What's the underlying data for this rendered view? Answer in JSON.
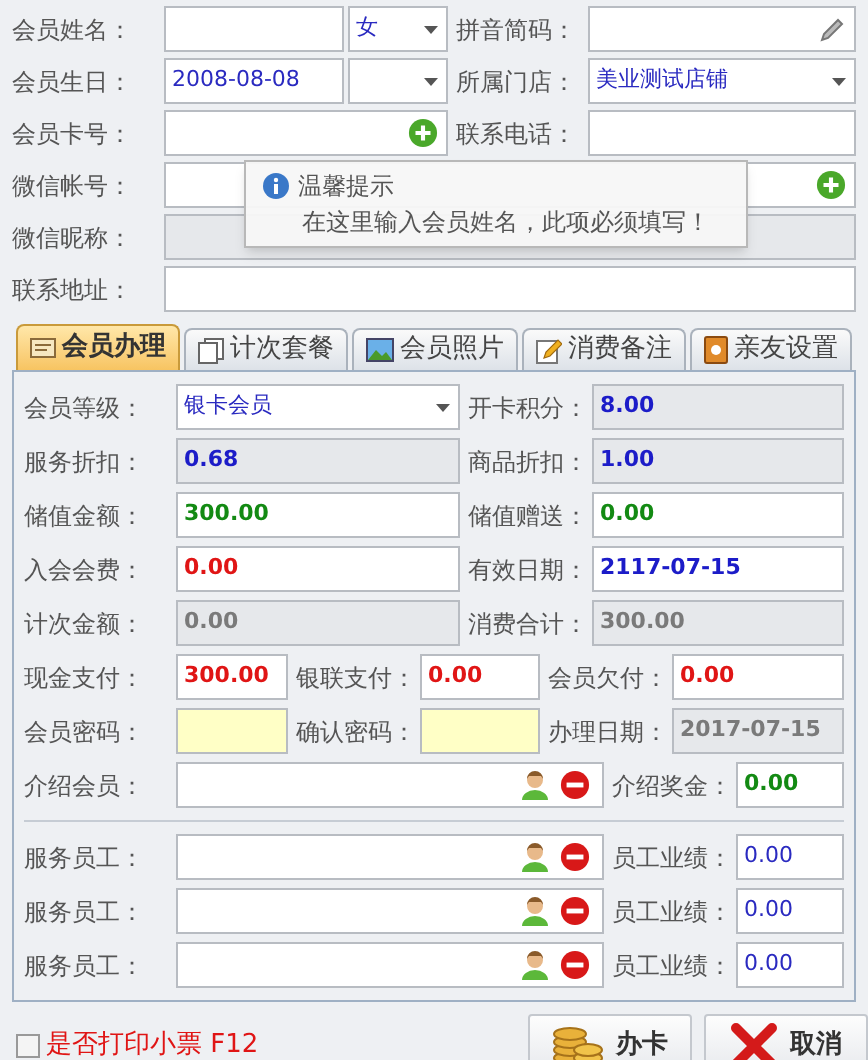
{
  "top_rows": [
    {
      "left": [
        {
          "label": "会员姓名：",
          "kind": "input"
        },
        {
          "kind": "select",
          "value": "女",
          "color": "#2a2ac0",
          "bold": false
        }
      ],
      "right": [
        {
          "label": "拼音简码：",
          "kind": "edit"
        }
      ]
    },
    {
      "left": [
        {
          "label": "会员生日：",
          "kind": "input",
          "value": "2008-08-08",
          "color": "#2a2ac0",
          "bold": false
        },
        {
          "kind": "select"
        }
      ],
      "right": [
        {
          "label": "所属门店：",
          "kind": "select",
          "value": "美业测试店铺",
          "color": "#2a2ac0",
          "bold": false
        }
      ]
    },
    {
      "left": [
        {
          "label": "会员卡号：",
          "kind": "add"
        }
      ],
      "right": [
        {
          "label": "联系电话：",
          "kind": "input"
        }
      ]
    },
    {
      "left": [
        {
          "label": "微信帐号：",
          "kind": "add"
        }
      ]
    },
    {
      "left": [
        {
          "label": "微信昵称：",
          "kind": "readonly"
        }
      ]
    },
    {
      "left": [
        {
          "label": "联系地址：",
          "kind": "input"
        }
      ]
    }
  ],
  "tooltip": {
    "title": "温馨提示",
    "message": "在这里输入会员姓名，此项必须填写！"
  },
  "tabs": [
    {
      "label": "会员办理",
      "selected": true,
      "kind": "card"
    },
    {
      "label": "计次套餐",
      "selected": false,
      "kind": "pages"
    },
    {
      "label": "会员照片",
      "selected": false,
      "kind": "photo"
    },
    {
      "label": "消费备注",
      "selected": false,
      "kind": "note"
    },
    {
      "label": "亲友设置",
      "selected": false,
      "kind": "contacts"
    }
  ],
  "panel_rows": [
    {
      "kind": "fields",
      "cells": [
        {
          "label": "会员等级：",
          "kind": "select",
          "value": "银卡会员",
          "color": "#2a2ac0",
          "bold": false
        },
        {
          "label": "开卡积分：",
          "kind": "readonly",
          "value": "8.00",
          "color": "#1c1cc8",
          "bold": true
        }
      ]
    },
    {
      "kind": "fields",
      "cells": [
        {
          "label": "服务折扣：",
          "kind": "readonly",
          "value": "0.68",
          "color": "#1c1cc8",
          "bold": true
        },
        {
          "label": "商品折扣：",
          "kind": "readonly",
          "value": "1.00",
          "color": "#1c1cc8",
          "bold": true
        }
      ]
    },
    {
      "kind": "fields",
      "cells": [
        {
          "label": "储值金额：",
          "kind": "input",
          "value": "300.00",
          "color": "#138a13",
          "bold": true
        },
        {
          "label": "储值赠送：",
          "kind": "input",
          "value": "0.00",
          "color": "#138a13",
          "bold": true
        }
      ]
    },
    {
      "kind": "fields",
      "cells": [
        {
          "label": "入会会费：",
          "kind": "input",
          "value": "0.00",
          "color": "#e01515",
          "bold": true
        },
        {
          "label": "有效日期：",
          "kind": "input",
          "value": "2117-07-15",
          "color": "#1c1cc8",
          "bold": true
        }
      ]
    },
    {
      "kind": "fields",
      "cells": [
        {
          "label": "计次金额：",
          "kind": "readonly",
          "value": "0.00",
          "color": "#7a7a7a",
          "bold": true
        },
        {
          "label": "消费合计：",
          "kind": "readonly",
          "value": "300.00",
          "color": "#7a7a7a",
          "bold": true
        }
      ]
    },
    {
      "kind": "fields",
      "cells": [
        {
          "label": "现金支付：",
          "kind": "input",
          "value": "300.00",
          "color": "#e01515",
          "bold": true
        },
        {
          "label": "银联支付：",
          "kind": "input",
          "value": "0.00",
          "color": "#e01515",
          "bold": true
        },
        {
          "label": "会员欠付：",
          "kind": "input",
          "value": "0.00",
          "color": "#e01515",
          "bold": true
        }
      ]
    },
    {
      "kind": "fields",
      "cells": [
        {
          "label": "会员密码：",
          "kind": "password"
        },
        {
          "label": "确认密码：",
          "kind": "password"
        },
        {
          "label": "办理日期：",
          "kind": "readonly",
          "value": "2017-07-15",
          "color": "#7a7a7a",
          "bold": true
        }
      ]
    },
    {
      "kind": "fields",
      "cells": [
        {
          "label": "介绍会员：",
          "kind": "picker"
        },
        {
          "label": "介绍奖金：",
          "kind": "input",
          "value": "0.00",
          "color": "#138a13",
          "bold": true
        }
      ]
    },
    {
      "kind": "divider"
    },
    {
      "kind": "fields",
      "cells": [
        {
          "label": "服务员工：",
          "kind": "picker"
        },
        {
          "label": "员工业绩：",
          "kind": "input",
          "value": "0.00",
          "color": "#2a2ac0",
          "bold": false
        }
      ]
    },
    {
      "kind": "fields",
      "cells": [
        {
          "label": "服务员工：",
          "kind": "picker"
        },
        {
          "label": "员工业绩：",
          "kind": "input",
          "value": "0.00",
          "color": "#2a2ac0",
          "bold": false
        }
      ]
    },
    {
      "kind": "fields",
      "cells": [
        {
          "label": "服务员工：",
          "kind": "picker"
        },
        {
          "label": "员工业绩：",
          "kind": "input",
          "value": "0.00",
          "color": "#2a2ac0",
          "bold": false
        }
      ]
    }
  ],
  "print_receipt": {
    "label": "是否打印小票 F12",
    "checked": false
  },
  "buttons": [
    {
      "kind": "issue",
      "label": "办卡"
    },
    {
      "kind": "cancel",
      "label": "取消"
    }
  ]
}
